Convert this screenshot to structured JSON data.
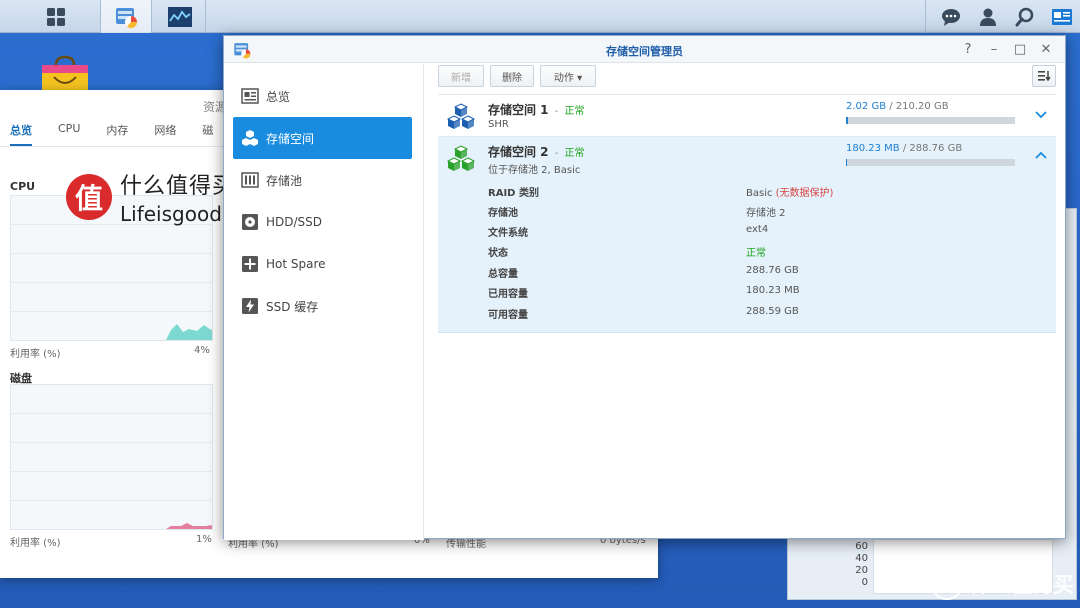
{
  "colors": {
    "accent": "#1a8ce0",
    "ok": "#1aa31a",
    "warn": "#d64541",
    "used": "#1f7fd0"
  },
  "taskbar": {
    "apps": [
      {
        "name": "main-menu",
        "icon": "grid-icon"
      },
      {
        "name": "storage-manager",
        "icon": "storage-manager-app-icon"
      },
      {
        "name": "resource-monitor",
        "icon": "resource-monitor-app-icon"
      }
    ],
    "right_icons": [
      "chat-icon",
      "user-icon",
      "search-icon",
      "widgets-icon"
    ]
  },
  "background_window": {
    "title": "资源",
    "tabs": [
      "总览",
      "CPU",
      "内存",
      "网络",
      "磁"
    ],
    "active_tab": "总览",
    "cpu": {
      "title": "CPU",
      "footer_label": "利用率 (%)",
      "footer_value": "4%"
    },
    "disk": {
      "title": "磁盘",
      "footer_label": "利用率 (%)",
      "footer_value": "1%"
    },
    "bottom": {
      "col1": "利用率 (%)",
      "col2": "0%",
      "col3": "传输性能",
      "col4": "0 bytes/s"
    }
  },
  "watermark": {
    "cn": "什么值得买",
    "en": "Lifeisgood",
    "mark": "值"
  },
  "watermark2": {
    "mark": "值",
    "text": "什么值得买"
  },
  "perf_panel": {
    "axis": [
      "60",
      "40",
      "20",
      "0"
    ]
  },
  "window": {
    "title": "存储空间管理员",
    "controls": [
      "?",
      "–",
      "□",
      "✕"
    ],
    "sidebar": [
      {
        "label": "总览",
        "icon": "overview-icon",
        "active": false
      },
      {
        "label": "存储空间",
        "icon": "volume-icon",
        "active": true
      },
      {
        "label": "存储池",
        "icon": "storage-pool-icon",
        "active": false
      },
      {
        "label": "HDD/SSD",
        "icon": "hdd-icon",
        "active": false
      },
      {
        "label": "Hot Spare",
        "icon": "hot-spare-icon",
        "active": false
      },
      {
        "label": "SSD 缓存",
        "icon": "ssd-cache-icon",
        "active": false
      }
    ],
    "toolbar": {
      "create": "新增",
      "delete": "删除",
      "action": "动作 ▾"
    },
    "volumes": [
      {
        "name": "存储空间 1",
        "sep": "-",
        "status": "正常",
        "sub": "SHR",
        "used": "2.02 GB",
        "total": " / 210.20 GB",
        "usage_fraction": 0.0096,
        "icon_color": "#1b5fb0",
        "expanded": false
      },
      {
        "name": "存储空间 2",
        "sep": "-",
        "status": "正常",
        "sub": "位于存储池 2, Basic",
        "used": "180.23 MB",
        "total": " / 288.76 GB",
        "usage_fraction": 0.0006,
        "icon_color": "#2aa12a",
        "expanded": true,
        "details": [
          {
            "label": "RAID 类别",
            "value": "Basic ",
            "note": "(无数据保护)"
          },
          {
            "label": "存储池",
            "value": "存储池 2"
          },
          {
            "label": "文件系统",
            "value": "ext4"
          },
          {
            "label": "状态",
            "value": "正常",
            "ok": true
          },
          {
            "label": "总容量",
            "value": "288.76 GB"
          },
          {
            "label": "已用容量",
            "value": "180.23 MB"
          },
          {
            "label": "可用容量",
            "value": "288.59 GB"
          }
        ]
      }
    ]
  }
}
